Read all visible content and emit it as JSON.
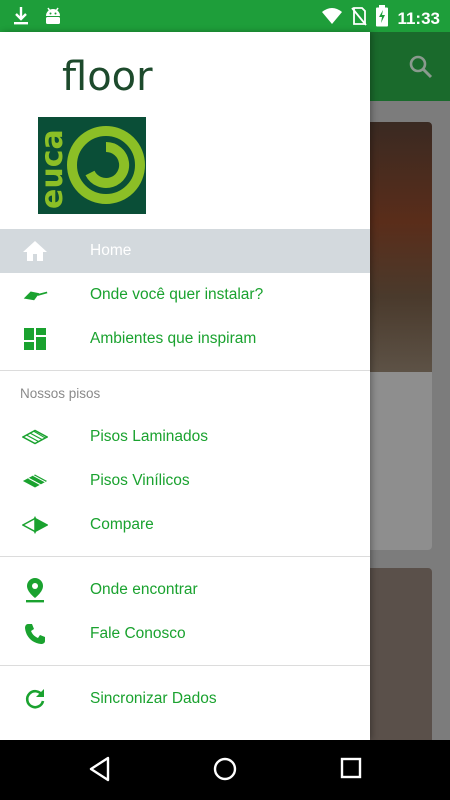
{
  "status_bar": {
    "time": "11:33",
    "icons": [
      "download-icon",
      "android-icon",
      "wifi-icon",
      "no-sim-icon",
      "battery-charging-icon"
    ],
    "bg_color": "#1e9e3a"
  },
  "logo": {
    "word": "floor",
    "brand": "euca",
    "brand_color": "#8cbf26",
    "box_color": "#0a4e37"
  },
  "drawer": {
    "items_top": [
      {
        "label": "Home",
        "icon": "home-icon",
        "active": true
      },
      {
        "label": "Onde você quer instalar?",
        "icon": "install-trowel-icon",
        "active": false
      },
      {
        "label": "Ambientes que inspiram",
        "icon": "dashboard-icon",
        "active": false
      }
    ],
    "section_title": "Nossos pisos",
    "items_floors": [
      {
        "label": "Pisos Laminados",
        "icon": "laminate-floor-icon"
      },
      {
        "label": "Pisos Vinílicos",
        "icon": "vinyl-floor-icon"
      },
      {
        "label": "Compare",
        "icon": "compare-floor-icon"
      }
    ],
    "items_contact": [
      {
        "label": "Onde encontrar",
        "icon": "location-pin-icon"
      },
      {
        "label": "Fale Conosco",
        "icon": "phone-icon"
      }
    ],
    "items_sync": [
      {
        "label": "Sincronizar Dados",
        "icon": "refresh-icon"
      }
    ],
    "accent_color": "#1aa22f",
    "active_bg": "#d3d9dd"
  },
  "nav_bar": {
    "buttons": [
      "back-icon",
      "home-circle-icon",
      "recents-icon"
    ]
  }
}
